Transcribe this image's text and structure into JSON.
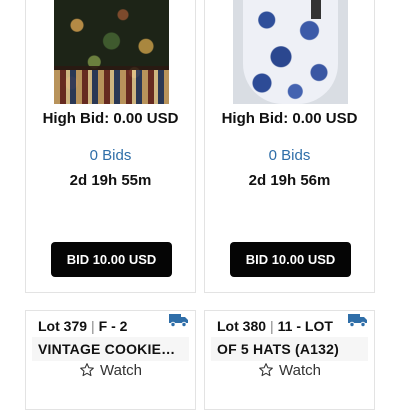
{
  "cards_top": [
    {
      "image": "rug-image",
      "high_bid": "High Bid: 0.00 USD",
      "bids": "0 Bids",
      "time_left": "2d 19h 55m",
      "bid_button": "BID 10.00 USD"
    },
    {
      "image": "vase-image",
      "high_bid": "High Bid: 0.00 USD",
      "bids": "0 Bids",
      "time_left": "2d 19h 56m",
      "bid_button": "BID 10.00 USD"
    }
  ],
  "cards_bottom": [
    {
      "lot_label": "Lot 379",
      "separator": "|",
      "lot_code": "F - 2",
      "title": "VINTAGE COOKIE…",
      "watch_label": "Watch",
      "shipping_icon": "truck-icon",
      "watch_icon": "star-outline-icon"
    },
    {
      "lot_label": "Lot 380",
      "separator": "|",
      "lot_code": "11 - LOT",
      "title": "OF 5 HATS (A132)",
      "watch_label": "Watch",
      "shipping_icon": "truck-icon",
      "watch_icon": "star-outline-icon"
    }
  ],
  "colors": {
    "button_bg": "#050505",
    "bids_link": "#2f6ea8",
    "truck_icon": "#2f6ea8"
  }
}
